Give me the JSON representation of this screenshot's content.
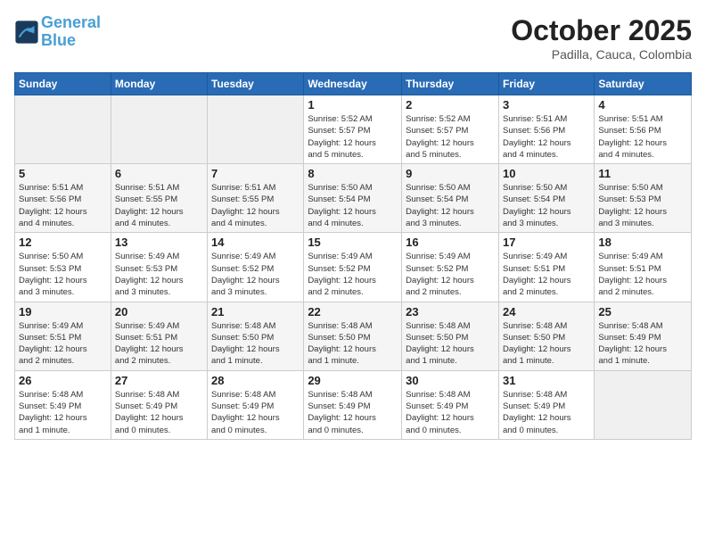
{
  "header": {
    "logo_line1": "General",
    "logo_line2": "Blue",
    "month": "October 2025",
    "location": "Padilla, Cauca, Colombia"
  },
  "weekdays": [
    "Sunday",
    "Monday",
    "Tuesday",
    "Wednesday",
    "Thursday",
    "Friday",
    "Saturday"
  ],
  "weeks": [
    [
      {
        "day": "",
        "info": ""
      },
      {
        "day": "",
        "info": ""
      },
      {
        "day": "",
        "info": ""
      },
      {
        "day": "1",
        "info": "Sunrise: 5:52 AM\nSunset: 5:57 PM\nDaylight: 12 hours\nand 5 minutes."
      },
      {
        "day": "2",
        "info": "Sunrise: 5:52 AM\nSunset: 5:57 PM\nDaylight: 12 hours\nand 5 minutes."
      },
      {
        "day": "3",
        "info": "Sunrise: 5:51 AM\nSunset: 5:56 PM\nDaylight: 12 hours\nand 4 minutes."
      },
      {
        "day": "4",
        "info": "Sunrise: 5:51 AM\nSunset: 5:56 PM\nDaylight: 12 hours\nand 4 minutes."
      }
    ],
    [
      {
        "day": "5",
        "info": "Sunrise: 5:51 AM\nSunset: 5:56 PM\nDaylight: 12 hours\nand 4 minutes."
      },
      {
        "day": "6",
        "info": "Sunrise: 5:51 AM\nSunset: 5:55 PM\nDaylight: 12 hours\nand 4 minutes."
      },
      {
        "day": "7",
        "info": "Sunrise: 5:51 AM\nSunset: 5:55 PM\nDaylight: 12 hours\nand 4 minutes."
      },
      {
        "day": "8",
        "info": "Sunrise: 5:50 AM\nSunset: 5:54 PM\nDaylight: 12 hours\nand 4 minutes."
      },
      {
        "day": "9",
        "info": "Sunrise: 5:50 AM\nSunset: 5:54 PM\nDaylight: 12 hours\nand 3 minutes."
      },
      {
        "day": "10",
        "info": "Sunrise: 5:50 AM\nSunset: 5:54 PM\nDaylight: 12 hours\nand 3 minutes."
      },
      {
        "day": "11",
        "info": "Sunrise: 5:50 AM\nSunset: 5:53 PM\nDaylight: 12 hours\nand 3 minutes."
      }
    ],
    [
      {
        "day": "12",
        "info": "Sunrise: 5:50 AM\nSunset: 5:53 PM\nDaylight: 12 hours\nand 3 minutes."
      },
      {
        "day": "13",
        "info": "Sunrise: 5:49 AM\nSunset: 5:53 PM\nDaylight: 12 hours\nand 3 minutes."
      },
      {
        "day": "14",
        "info": "Sunrise: 5:49 AM\nSunset: 5:52 PM\nDaylight: 12 hours\nand 3 minutes."
      },
      {
        "day": "15",
        "info": "Sunrise: 5:49 AM\nSunset: 5:52 PM\nDaylight: 12 hours\nand 2 minutes."
      },
      {
        "day": "16",
        "info": "Sunrise: 5:49 AM\nSunset: 5:52 PM\nDaylight: 12 hours\nand 2 minutes."
      },
      {
        "day": "17",
        "info": "Sunrise: 5:49 AM\nSunset: 5:51 PM\nDaylight: 12 hours\nand 2 minutes."
      },
      {
        "day": "18",
        "info": "Sunrise: 5:49 AM\nSunset: 5:51 PM\nDaylight: 12 hours\nand 2 minutes."
      }
    ],
    [
      {
        "day": "19",
        "info": "Sunrise: 5:49 AM\nSunset: 5:51 PM\nDaylight: 12 hours\nand 2 minutes."
      },
      {
        "day": "20",
        "info": "Sunrise: 5:49 AM\nSunset: 5:51 PM\nDaylight: 12 hours\nand 2 minutes."
      },
      {
        "day": "21",
        "info": "Sunrise: 5:48 AM\nSunset: 5:50 PM\nDaylight: 12 hours\nand 1 minute."
      },
      {
        "day": "22",
        "info": "Sunrise: 5:48 AM\nSunset: 5:50 PM\nDaylight: 12 hours\nand 1 minute."
      },
      {
        "day": "23",
        "info": "Sunrise: 5:48 AM\nSunset: 5:50 PM\nDaylight: 12 hours\nand 1 minute."
      },
      {
        "day": "24",
        "info": "Sunrise: 5:48 AM\nSunset: 5:50 PM\nDaylight: 12 hours\nand 1 minute."
      },
      {
        "day": "25",
        "info": "Sunrise: 5:48 AM\nSunset: 5:49 PM\nDaylight: 12 hours\nand 1 minute."
      }
    ],
    [
      {
        "day": "26",
        "info": "Sunrise: 5:48 AM\nSunset: 5:49 PM\nDaylight: 12 hours\nand 1 minute."
      },
      {
        "day": "27",
        "info": "Sunrise: 5:48 AM\nSunset: 5:49 PM\nDaylight: 12 hours\nand 0 minutes."
      },
      {
        "day": "28",
        "info": "Sunrise: 5:48 AM\nSunset: 5:49 PM\nDaylight: 12 hours\nand 0 minutes."
      },
      {
        "day": "29",
        "info": "Sunrise: 5:48 AM\nSunset: 5:49 PM\nDaylight: 12 hours\nand 0 minutes."
      },
      {
        "day": "30",
        "info": "Sunrise: 5:48 AM\nSunset: 5:49 PM\nDaylight: 12 hours\nand 0 minutes."
      },
      {
        "day": "31",
        "info": "Sunrise: 5:48 AM\nSunset: 5:49 PM\nDaylight: 12 hours\nand 0 minutes."
      },
      {
        "day": "",
        "info": ""
      }
    ]
  ]
}
